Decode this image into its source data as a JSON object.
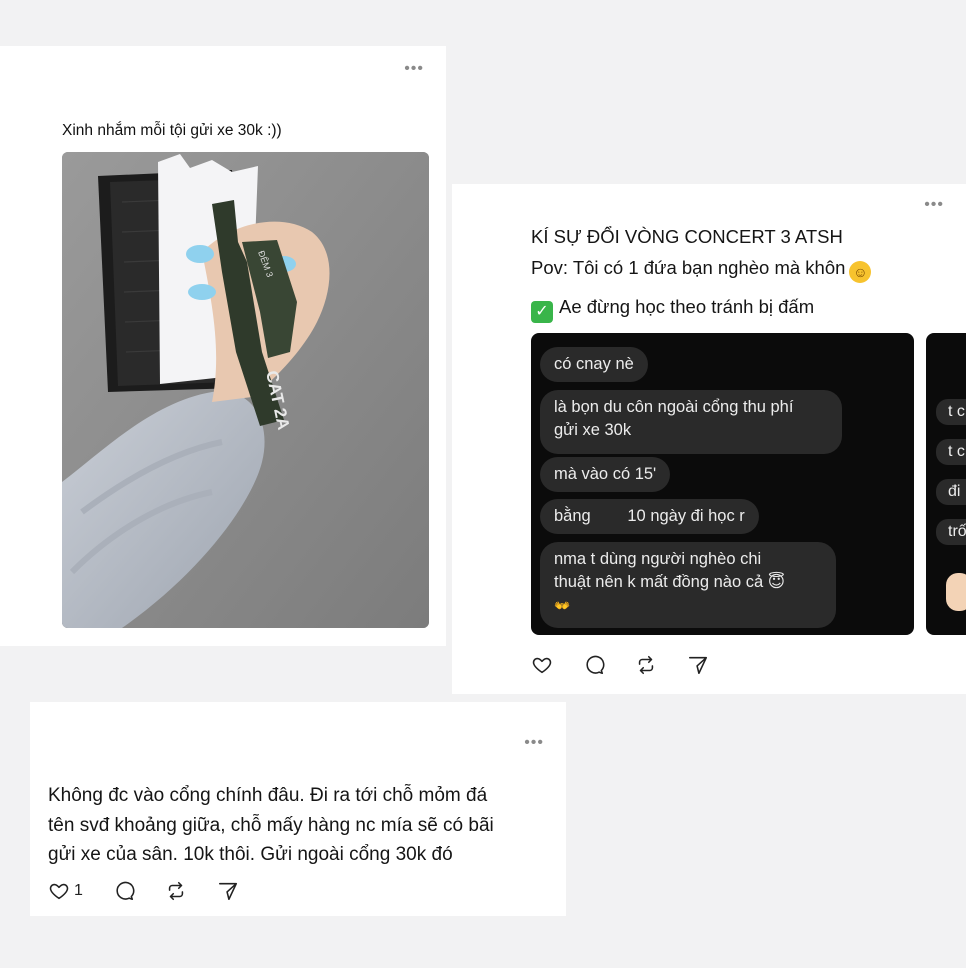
{
  "post1": {
    "text": "Xinh nhắm mỗi tội gửi xe 30k :))",
    "menu_icon": "more-dots-icon",
    "photo_caption": "CAT 2A",
    "wristband_text": "ĐÊM 3"
  },
  "post2": {
    "title": "KÍ SỰ ĐỔI VÒNG CONCERT 3 ATSH",
    "pov": "Pov: Tôi có 1 đứa bạn nghèo mà khôn",
    "advice": "Ae đừng học theo tránh bị đấm",
    "chat_messages": [
      "có cnay nè",
      "là bọn du côn ngoài cổng thu phí",
      "gửi xe 30k",
      "mà vào có 15'",
      "bằng        10 ngày đi học r",
      "nma t dùng người nghèo chi",
      "thuật nên k mất đồng nào cả 😇",
      "👐"
    ],
    "second_image_messages": [
      "t c",
      "t c",
      "đi",
      "trố"
    ],
    "colors": {
      "chat_bg": "#0b0b0b",
      "bubble": "#2a2a2a",
      "check": "#39b54a"
    }
  },
  "post3": {
    "text": "Không đc vào cổng chính đâu. Đi ra tới chỗ mỏm đá\ntên svđ khoảng giữa, chỗ mấy hàng nc mía sẽ có bãi\ngửi xe của sân. 10k thôi. Gửi ngoài cổng 30k đó",
    "like_count": "1"
  },
  "icons": [
    "heart-icon",
    "comment-icon",
    "repost-icon",
    "share-icon"
  ]
}
